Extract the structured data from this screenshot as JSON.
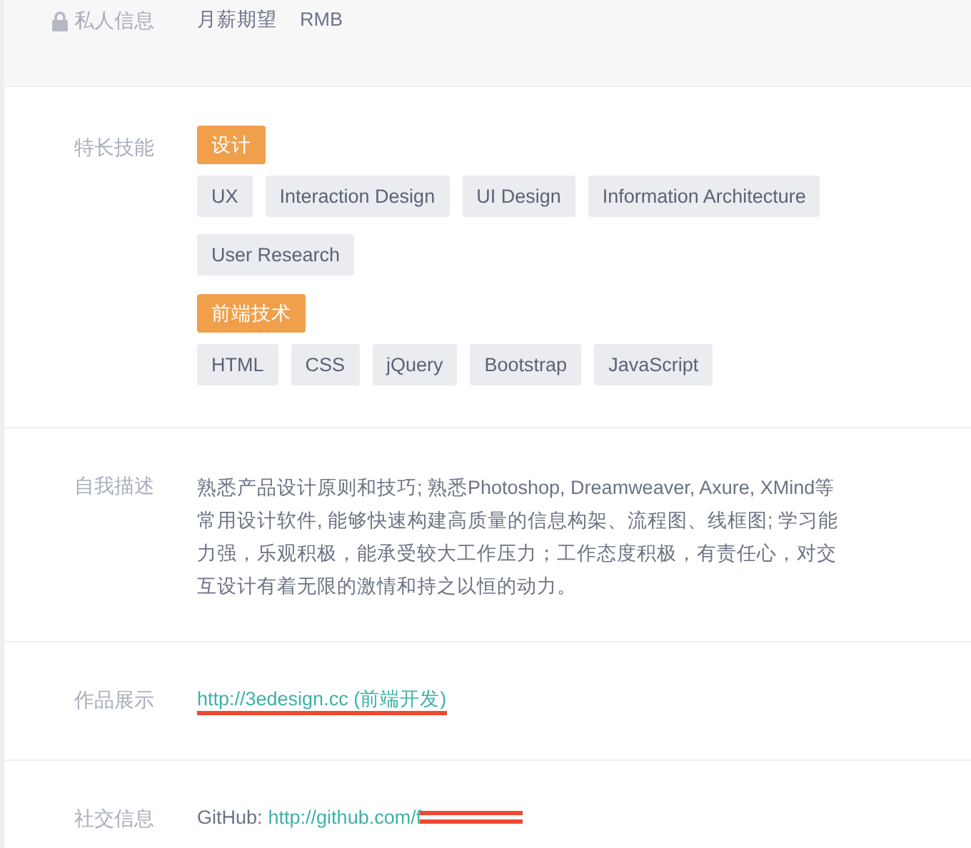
{
  "private_info": {
    "label": "私人信息",
    "items": [
      "月薪期望",
      "RMB"
    ]
  },
  "sections": [
    {
      "kind": "skills",
      "label": "特长技能",
      "groups": [
        {
          "category": "设计",
          "tags": [
            "UX",
            "Interaction Design",
            "UI Design",
            "Information Architecture",
            "User Research"
          ]
        },
        {
          "category": "前端技术",
          "tags": [
            "HTML",
            "CSS",
            "jQuery",
            "Bootstrap",
            "JavaScript"
          ]
        }
      ]
    },
    {
      "kind": "text",
      "label": "自我描述",
      "text": "熟悉产品设计原则和技巧; 熟悉Photoshop, Dreamweaver, Axure, XMind等常用设计软件, 能够快速构建高质量的信息构架、流程图、线框图; 学习能力强，乐观积极，能承受较大工作压力；工作态度积极，有责任心，对交互设计有着无限的激情和持之以恒的动力。"
    },
    {
      "kind": "link",
      "label": "作品展示",
      "link": "http://3edesign.cc (前端开发)"
    },
    {
      "kind": "social",
      "label": "社交信息",
      "prefix": "GitHub:",
      "link": "http://github.com/f"
    }
  ]
}
